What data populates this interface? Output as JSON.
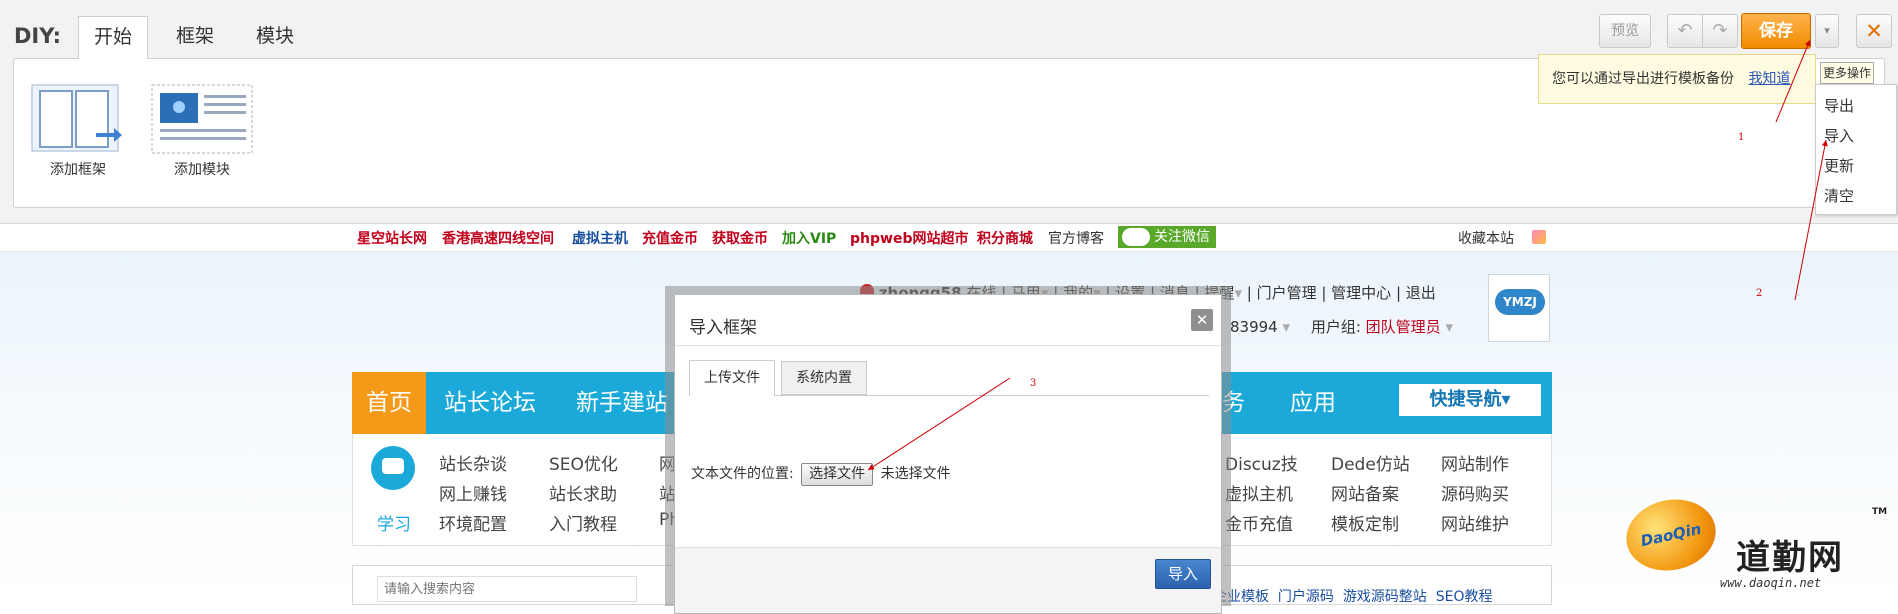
{
  "diy": {
    "label": "DIY:",
    "tabs": [
      "开始",
      "框架",
      "模块"
    ],
    "add_items": [
      "添加框架",
      "添加模块"
    ],
    "buttons": {
      "preview": "预览",
      "undo": "↶",
      "redo": "↷",
      "save": "保存",
      "more": "▾",
      "close": "✕"
    },
    "tip": {
      "text": "您可以通过导出进行模板备份",
      "link": "我知道"
    },
    "tooltip": "更多操作",
    "menu": [
      "导出",
      "导入",
      "更新",
      "清空"
    ]
  },
  "top_links": [
    {
      "text": "星空站长网",
      "color": "#c0001b"
    },
    {
      "text": "香港高速四线空间",
      "color": "#c0001b"
    },
    {
      "text": "虚拟主机",
      "color": "#1a4fa0"
    },
    {
      "text": "充值金币",
      "color": "#c0001b"
    },
    {
      "text": "获取金币",
      "color": "#c0001b"
    },
    {
      "text": "加入VIP",
      "color": "#2a8a12"
    },
    {
      "text": "phpweb网站超市",
      "color": "#c0001b"
    },
    {
      "text": "积分商城",
      "color": "#c0001b"
    },
    {
      "text": "官方博客",
      "color": "#333333"
    }
  ],
  "wechat_label": "关注微信",
  "favorite": "收藏本站",
  "user_bar": {
    "items": [
      "zhongq58",
      "在线",
      "马甲",
      "我的",
      "设置",
      "消息",
      "提醒",
      "门户管理",
      "管理中心",
      "退出"
    ],
    "points": "83994",
    "group_label": "用户组:",
    "group_value": "团队管理员",
    "logo_text": "YMZJ"
  },
  "nav": {
    "items": [
      "首页",
      "站长论坛",
      "新手建站",
      "务",
      "应用"
    ],
    "quick": "快捷导航▾"
  },
  "sub_nav": {
    "icon_label": "学习",
    "col1": [
      "站长杂谈",
      "网上赚钱",
      "环境配置"
    ],
    "col2": [
      "SEO优化",
      "站长求助",
      "入门教程"
    ],
    "col3": [
      "网",
      "站",
      "Ph"
    ],
    "col4": [
      "Discuz技",
      "虚拟主机",
      "金币充值"
    ],
    "col5": [
      "Dede仿站",
      "网站备案",
      "模板定制"
    ],
    "col6": [
      "网站制作",
      "源码购买",
      "网站维护"
    ]
  },
  "search": {
    "placeholder": "请输入搜索内容",
    "links": [
      "企业模板",
      "门户源码",
      "游戏源码整站",
      "SEO教程"
    ]
  },
  "dialog": {
    "title": "导入框架",
    "close": "✕",
    "tabs": [
      "上传文件",
      "系统内置"
    ],
    "field_label": "文本文件的位置:",
    "file_button": "选择文件",
    "file_status": "未选择文件",
    "submit": "导入"
  },
  "annotations": [
    "1",
    "2",
    "3"
  ],
  "watermark": {
    "logo_text": "DaoQin",
    "name": "道勤网",
    "tm": "TM",
    "url": "www.daoqin.net"
  }
}
